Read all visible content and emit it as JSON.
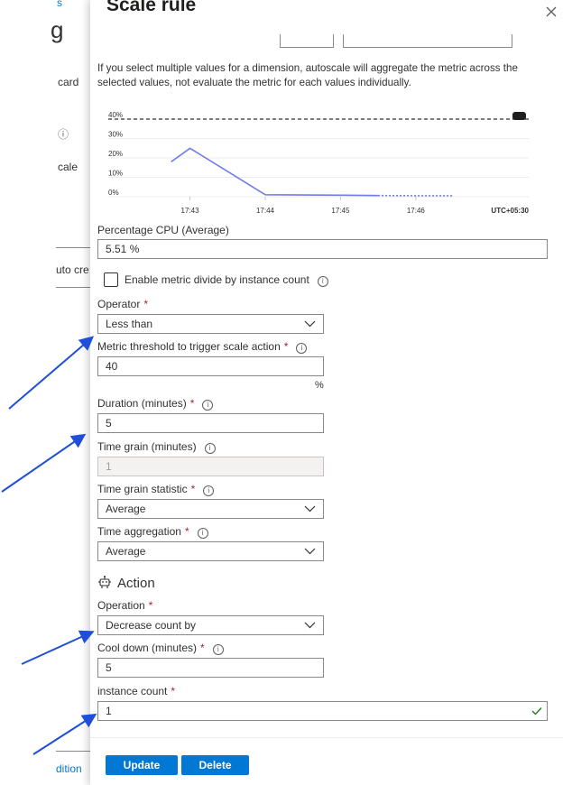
{
  "background": {
    "fragments": [
      "s",
      "g",
      "card",
      "ⓘ",
      "cale",
      "uto cre",
      "dition"
    ]
  },
  "panel": {
    "title": "Scale rule",
    "close_icon": "close-icon",
    "note": "If you select multiple values for a dimension, autoscale will aggregate the metric across the selected values, not evaluate the metric for each values individually."
  },
  "chart_data": {
    "type": "line",
    "x": [
      "17:42:45",
      "17:43",
      "17:44",
      "17:45",
      "17:45:30",
      "17:46",
      "17:46:30"
    ],
    "series": [
      {
        "values": [
          18,
          25,
          1,
          0.8,
          0.6,
          0.5,
          0.5
        ]
      }
    ],
    "threshold": 40,
    "x_ticks": [
      "17:43",
      "17:44",
      "17:45",
      "17:46"
    ],
    "y_ticks": [
      "0%",
      "10%",
      "20%",
      "30%",
      "40%"
    ],
    "timezone_label": "UTC+05:30",
    "ylim": [
      0,
      40
    ],
    "line_color": "#6f7de9"
  },
  "metric": {
    "label": "Percentage CPU (Average)",
    "value": "5.51 %"
  },
  "divide": {
    "label": "Enable metric divide by instance count",
    "checked": false
  },
  "operator": {
    "label": "Operator",
    "value": "Less than"
  },
  "threshold": {
    "label": "Metric threshold to trigger scale action",
    "value": "40",
    "unit": "%"
  },
  "duration": {
    "label": "Duration (minutes)",
    "value": "5"
  },
  "time_grain": {
    "label": "Time grain (minutes)",
    "value": "1"
  },
  "time_grain_statistic": {
    "label": "Time grain statistic",
    "value": "Average"
  },
  "time_aggregation": {
    "label": "Time aggregation",
    "value": "Average"
  },
  "action": {
    "title": "Action",
    "operation": {
      "label": "Operation",
      "value": "Decrease count by"
    },
    "cool_down": {
      "label": "Cool down (minutes)",
      "value": "5"
    },
    "instance_count": {
      "label": "instance count",
      "value": "1"
    }
  },
  "buttons": {
    "update": "Update",
    "delete": "Delete"
  },
  "colors": {
    "accent": "#0078d4",
    "required": "#a4262c",
    "arrow": "#1f4fd8",
    "valid": "#107c10"
  }
}
